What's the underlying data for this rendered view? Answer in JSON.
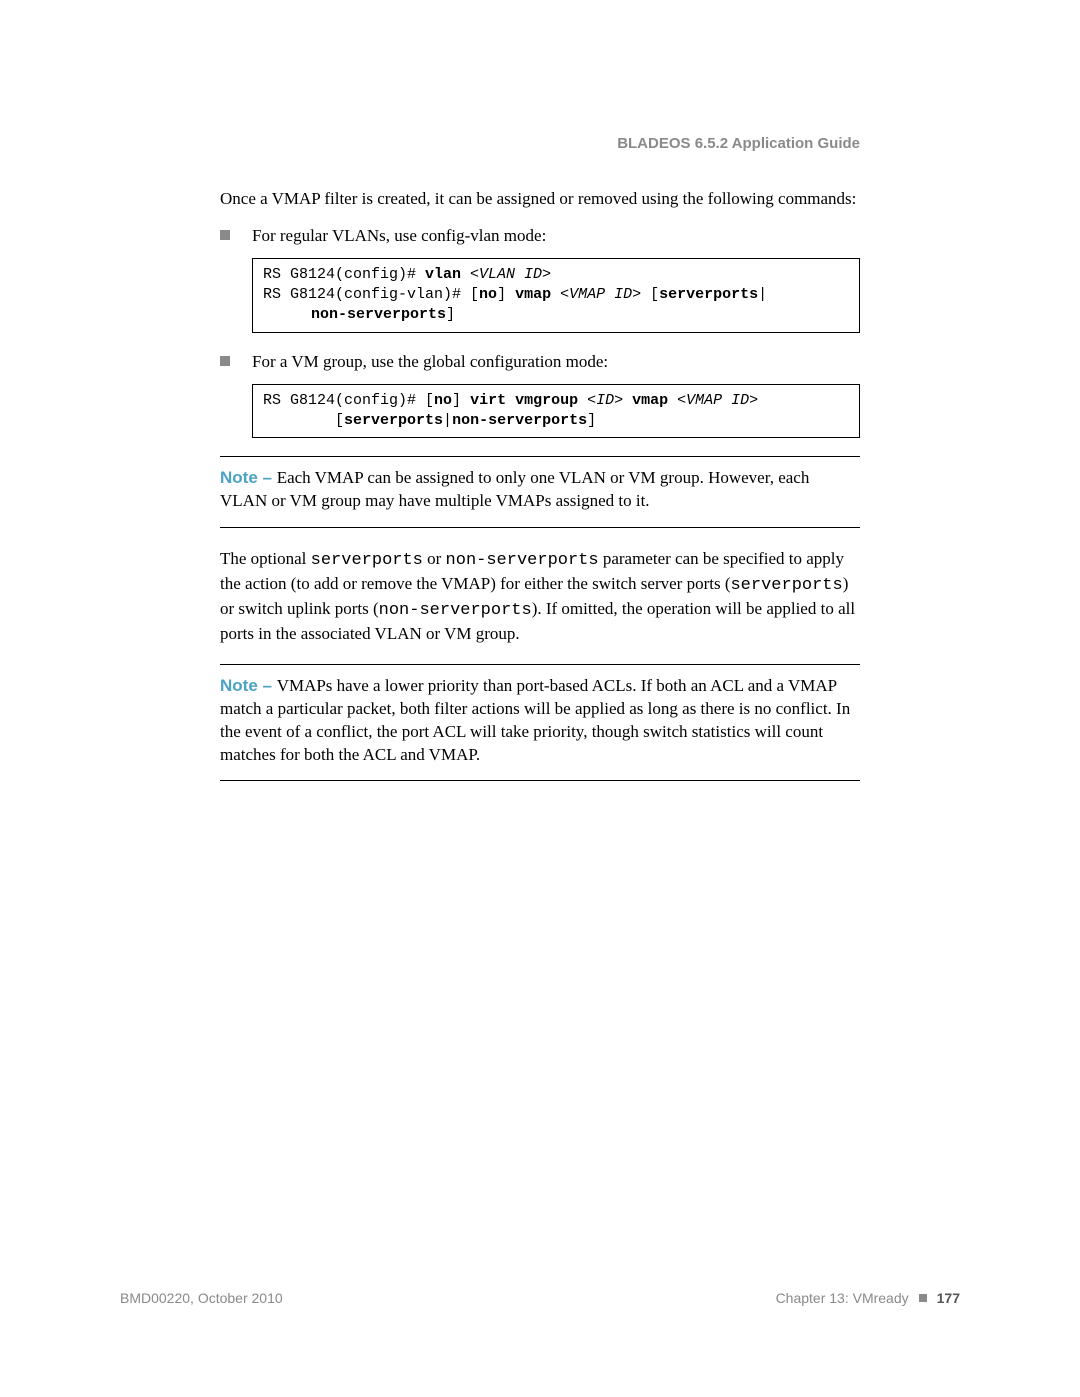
{
  "header": {
    "title": "BLADEOS 6.5.2 Application Guide"
  },
  "content": {
    "intro": "Once a VMAP filter is created, it can be assigned or removed using the following commands:",
    "bullet1": "For regular VLANs, use config-vlan mode:",
    "code1": {
      "l1_prefix": "RS G8124(config)# ",
      "l1_cmd": "vlan ",
      "l1_arg": "<VLAN ID>",
      "l2_prefix": "RS G8124(config-vlan)# [",
      "l2_no": "no",
      "l2_mid1": "] ",
      "l2_vmap": "vmap ",
      "l2_arg": "<VMAP ID>",
      "l2_mid2": " [",
      "l2_sp": "serverports",
      "l2_pipe": "|",
      "l3_nsp": "non-serverports",
      "l3_close": "]"
    },
    "bullet2": "For a VM group, use the global configuration mode:",
    "code2": {
      "l1_prefix": "RS G8124(config)# [",
      "l1_no": "no",
      "l1_mid1": "] ",
      "l1_virt": "virt vmgroup ",
      "l1_id": "<ID>",
      "l1_sp": " ",
      "l1_vmap": "vmap ",
      "l1_vmapid": "<VMAP ID>",
      "l2_open": "[",
      "l2_sp": "serverports",
      "l2_pipe": "|",
      "l2_nsp": "non-serverports",
      "l2_close": "]"
    },
    "note1_label": "Note – ",
    "note1_text": "Each VMAP can be assigned to only one VLAN or VM group. However, each VLAN or VM group may have multiple VMAPs assigned to it.",
    "para_optional_1": "The optional ",
    "para_optional_sp": "serverports",
    "para_optional_2": " or ",
    "para_optional_nsp": "non-serverports",
    "para_optional_3": " parameter can be specified to apply the action (to add or remove the VMAP) for either the switch server ports (",
    "para_optional_sp2": "serverports",
    "para_optional_4": ") or switch uplink ports (",
    "para_optional_nsp2": "non-serverports",
    "para_optional_5": "). If omitted, the operation will be applied to all ports in the associated VLAN or VM group.",
    "note2_label": "Note – ",
    "note2_text": "VMAPs have a lower priority than port-based ACLs. If both an ACL and a VMAP match a particular packet, both filter actions will be applied as long as there is no conflict. In the event of a conflict, the port ACL will take priority, though switch statistics will count matches for both the ACL and VMAP."
  },
  "footer": {
    "left": "BMD00220, October 2010",
    "chapter": "Chapter 13: VMready",
    "page": "177"
  }
}
